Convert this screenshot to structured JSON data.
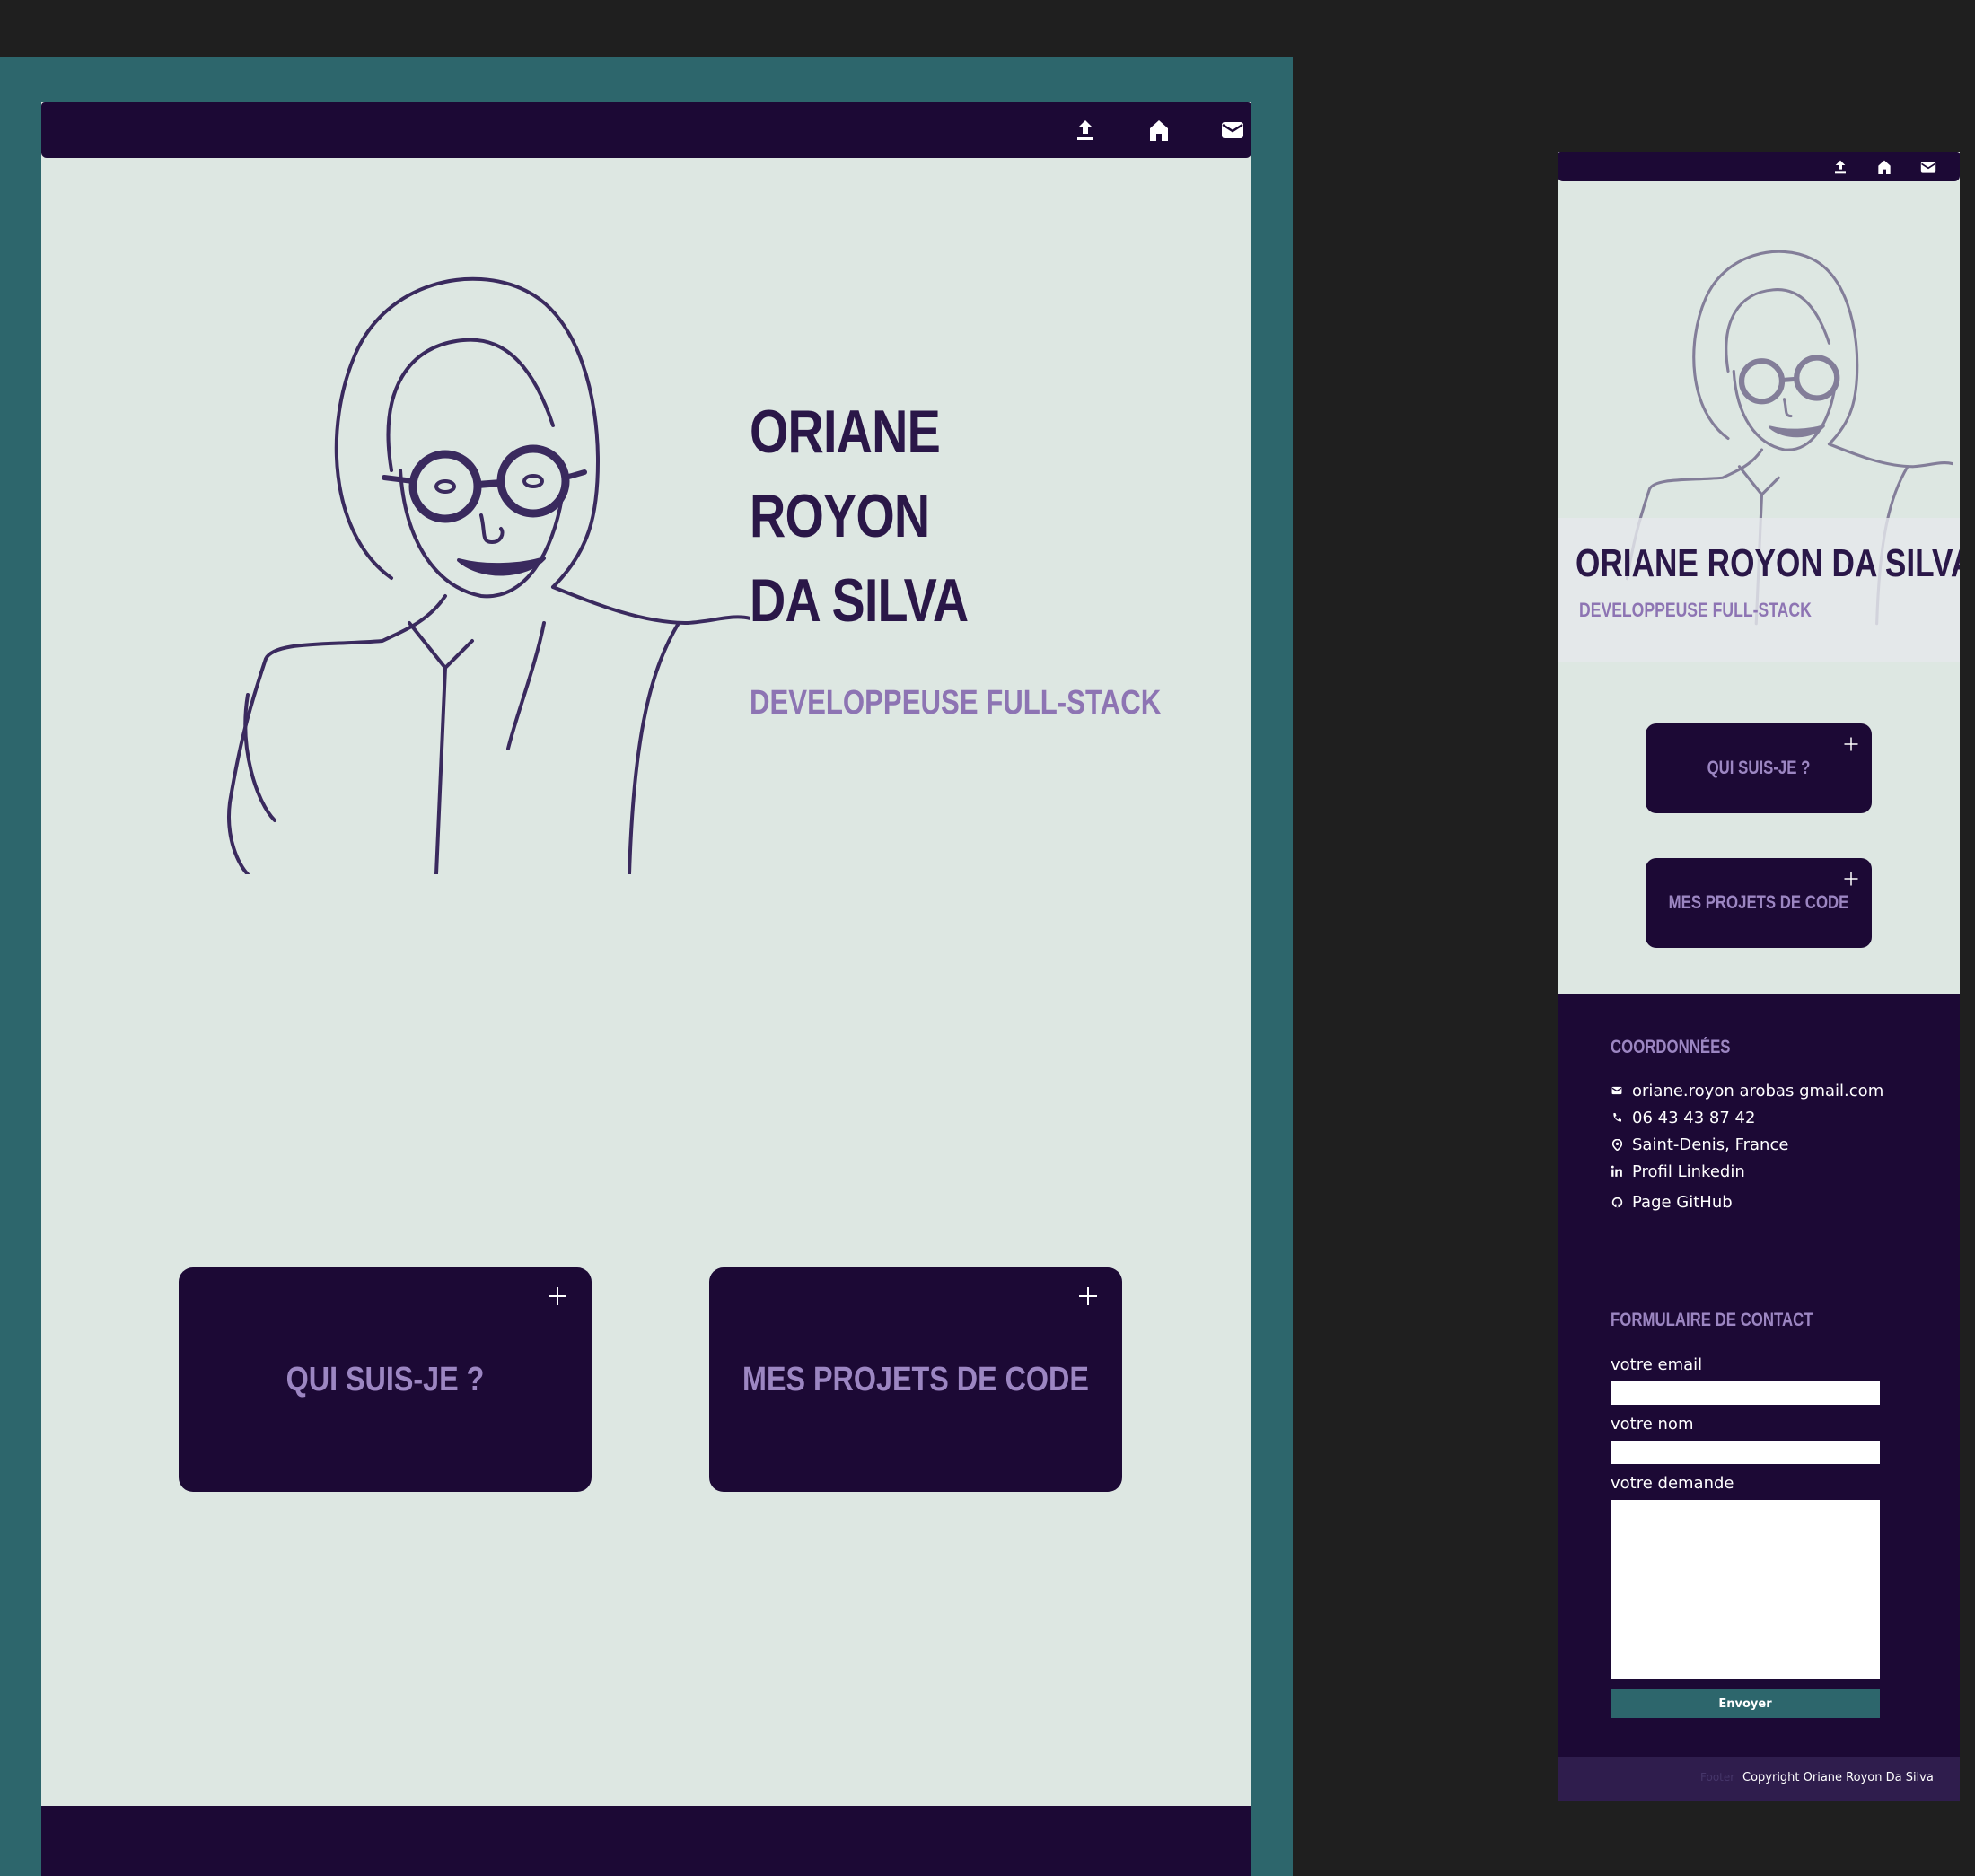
{
  "colors": {
    "background": "#1f1f1f",
    "frame_teal": "#2d666c",
    "page_bg": "#dde7e2",
    "navy": "#1c0935",
    "name_text": "#2a1748",
    "lavender": "#8d74b3",
    "card_text": "#9c86c2"
  },
  "nav": {
    "icons": [
      "upload-icon",
      "home-icon",
      "mail-icon"
    ]
  },
  "hero": {
    "name_line1": "ORIANE",
    "name_line2": "ROYON",
    "name_line3": "DA SILVA",
    "name_full": "ORIANE ROYON DA SILVA",
    "subtitle": "DEVELOPPEUSE FULL-STACK"
  },
  "cards": {
    "about": "QUI SUIS-JE ?",
    "projects": "MES PROJETS DE CODE"
  },
  "contact": {
    "title": "COORDONNÉES",
    "email": "oriane.royon arobas gmail.com",
    "phone": "06 43 43 87 42",
    "location": "Saint-Denis, France",
    "linkedin": "Profil Linkedin",
    "github": "Page GitHub"
  },
  "form": {
    "title": "FORMULAIRE DE CONTACT",
    "email_label": "votre email",
    "name_label": "votre nom",
    "request_label": "votre demande",
    "submit": "Envoyer"
  },
  "footer": {
    "ghost": "Footer",
    "copyright": "Copyright Oriane Royon Da Silva"
  }
}
